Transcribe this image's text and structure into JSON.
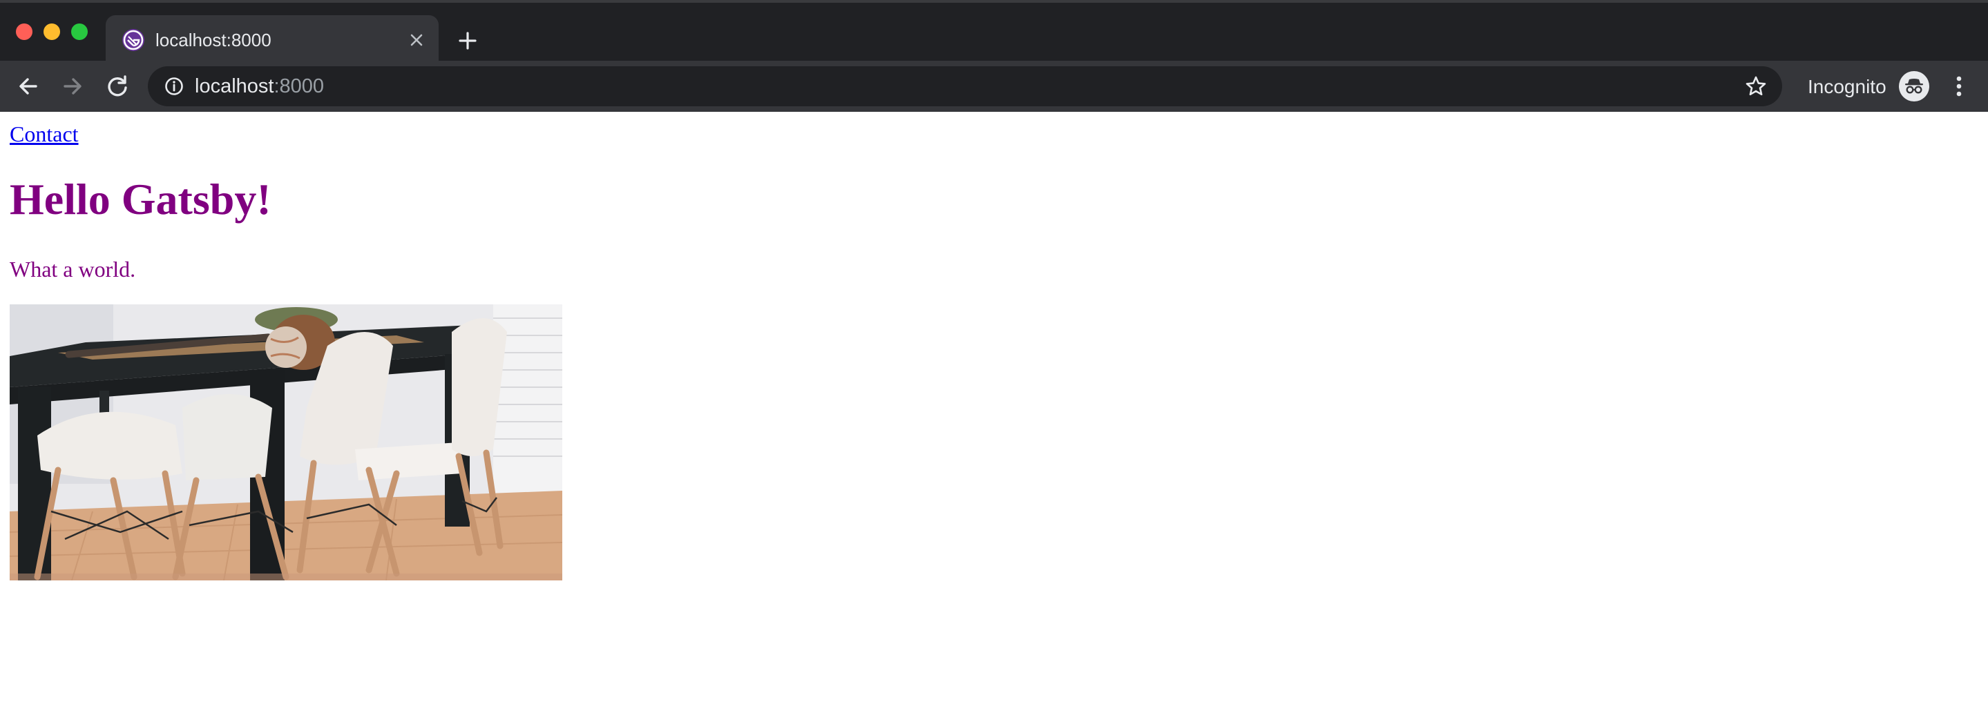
{
  "window": {
    "controls": [
      "close",
      "minimize",
      "zoom"
    ]
  },
  "tab": {
    "title": "localhost:8000",
    "favicon": "gatsby-logo-icon"
  },
  "toolbar": {
    "url_host": "localhost",
    "url_port": ":8000",
    "profile_label": "Incognito"
  },
  "page": {
    "nav_link": "Contact",
    "heading": "Hello Gatsby!",
    "text": "What a world.",
    "image": "dining-table-chairs-photo"
  },
  "colors": {
    "heading": "#800080",
    "link": "#0000ee",
    "chrome_dark": "#202124",
    "chrome_toolbar": "#35363a"
  }
}
